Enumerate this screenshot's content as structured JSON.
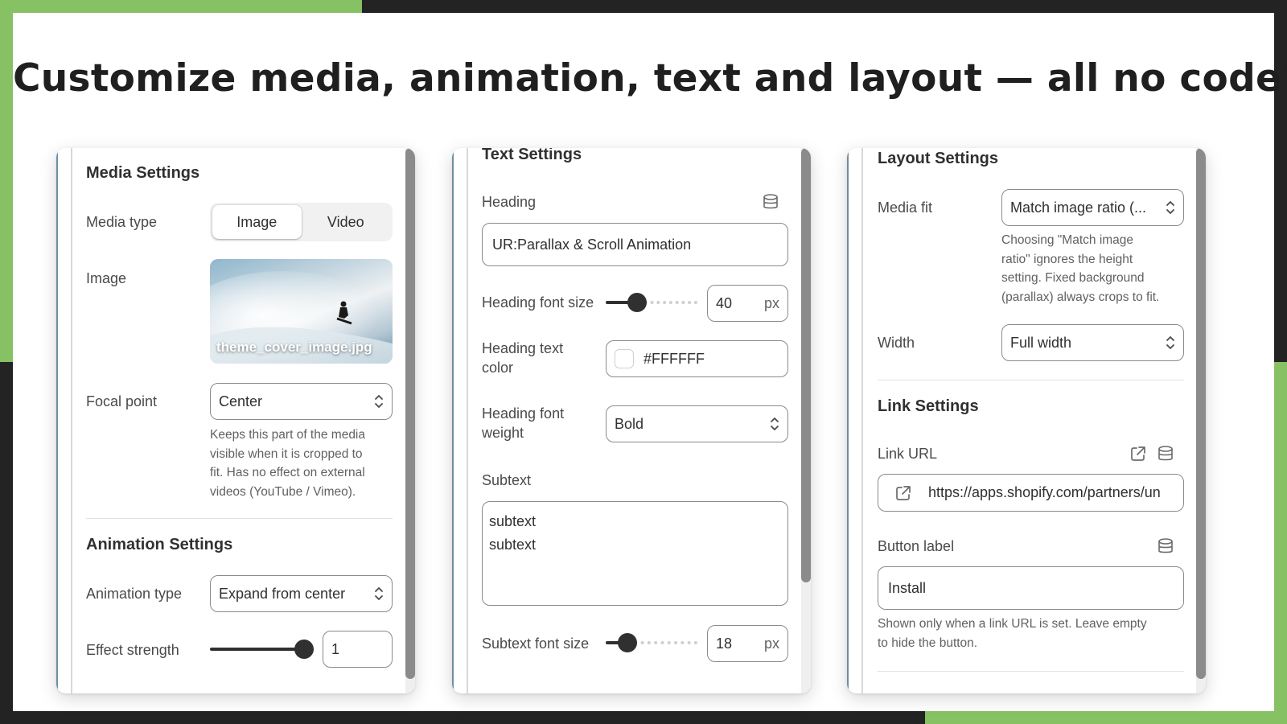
{
  "headline": "Customize media, animation, text and layout — all no code!",
  "media_panel": {
    "section_title": "Media Settings",
    "media_type_label": "Media type",
    "media_type_options": [
      "Image",
      "Video"
    ],
    "media_type_selected": "Image",
    "image_label": "Image",
    "image_filename": "theme_cover_image.jpg",
    "focal_point_label": "Focal point",
    "focal_point_value": "Center",
    "focal_point_help": [
      "Keeps this part of the media",
      "visible when it is cropped to",
      "fit. Has no effect on external",
      "videos (YouTube / Vimeo)."
    ],
    "animation_section_title": "Animation Settings",
    "animation_type_label": "Animation type",
    "animation_type_value": "Expand from center",
    "effect_strength_label": "Effect strength",
    "effect_strength_value": "1",
    "effect_strength_fraction": 1.0
  },
  "text_panel": {
    "section_title": "Text Settings",
    "heading_label": "Heading",
    "heading_value": "UR:Parallax & Scroll Animation",
    "heading_font_size_label": "Heading font size",
    "heading_font_size_value": "40",
    "heading_font_size_unit": "px",
    "heading_text_color_label": [
      "Heading text",
      "color"
    ],
    "heading_text_color_value": "#FFFFFF",
    "heading_font_weight_label": [
      "Heading font",
      "weight"
    ],
    "heading_font_weight_value": "Bold",
    "subtext_label": "Subtext",
    "subtext_lines": [
      "subtext",
      "subtext"
    ],
    "subtext_font_size_label": "Subtext font size",
    "subtext_font_size_value": "18",
    "subtext_font_size_unit": "px"
  },
  "layout_panel": {
    "section_title": "Layout Settings",
    "media_fit_label": "Media fit",
    "media_fit_value": "Match image ratio (...",
    "media_fit_help": [
      "Choosing \"Match image",
      "ratio\" ignores the height",
      "setting. Fixed background",
      "(parallax) always crops to fit."
    ],
    "width_label": "Width",
    "width_value": "Full width",
    "link_section_title": "Link Settings",
    "link_url_label": "Link URL",
    "link_url_value": "https://apps.shopify.com/partners/un",
    "button_label_label": "Button label",
    "button_label_value": "Install",
    "button_help": [
      "Shown only when a link URL is set. Leave empty",
      "to hide the button."
    ]
  },
  "icons": {
    "database": "database-icon",
    "external_link": "external-link-icon",
    "chevron": "chevron-up-down-icon"
  },
  "colors": {
    "accent_green": "#86c164",
    "frame_dark": "#232323",
    "text_dark": "#303030"
  }
}
